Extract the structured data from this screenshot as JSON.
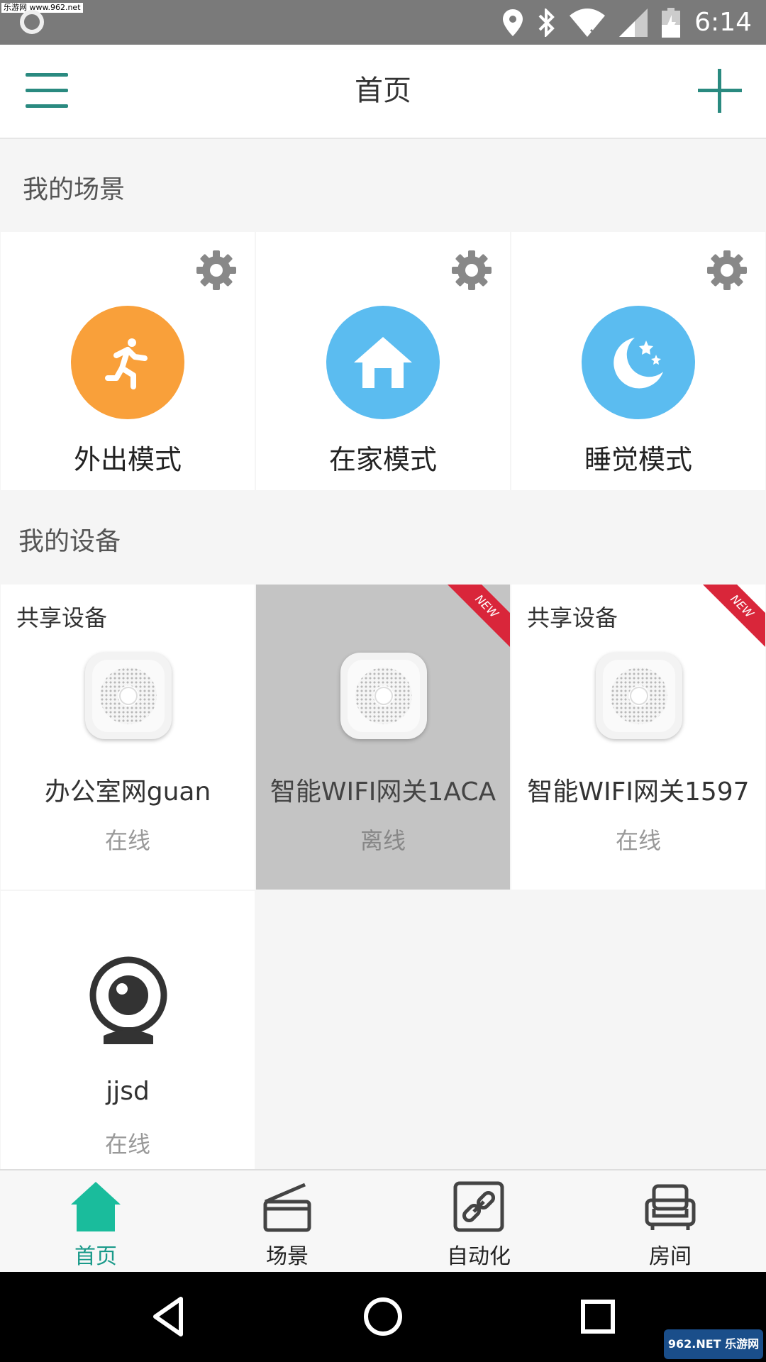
{
  "status_bar": {
    "time": "6:14",
    "watermark": "乐游网 www.962.net"
  },
  "header": {
    "title": "首页"
  },
  "scenes": {
    "section_label": "我的场景",
    "items": [
      {
        "name": "外出模式",
        "color": "#f9a03a",
        "icon": "running-person-icon"
      },
      {
        "name": "在家模式",
        "color": "#5bbcf0",
        "icon": "home-icon"
      },
      {
        "name": "睡觉模式",
        "color": "#5bbcf0",
        "icon": "moon-stars-icon"
      }
    ]
  },
  "devices": {
    "section_label": "我的设备",
    "items": [
      {
        "shared_label": "共享设备",
        "name": "办公室网guan",
        "status": "在线",
        "is_new": false,
        "offline": false
      },
      {
        "shared_label": "",
        "name": "智能WIFI网关1ACA",
        "status": "离线",
        "is_new": true,
        "offline": true
      },
      {
        "shared_label": "共享设备",
        "name": "智能WIFI网关1597",
        "status": "在线",
        "is_new": true,
        "offline": false
      },
      {
        "shared_label": "",
        "name": "jjsd",
        "status": "在线",
        "is_new": false,
        "offline": false
      }
    ],
    "new_badge": "NEW"
  },
  "bottom_nav": {
    "items": [
      {
        "label": "首页",
        "icon": "home-icon",
        "active": true
      },
      {
        "label": "场景",
        "icon": "clapperboard-icon",
        "active": false
      },
      {
        "label": "自动化",
        "icon": "link-icon",
        "active": false
      },
      {
        "label": "房间",
        "icon": "sofa-icon",
        "active": false
      }
    ]
  },
  "corner_watermark": "962.NET 乐游网",
  "colors": {
    "accent": "#2a8a80",
    "active_nav": "#1abc9c",
    "new_badge": "#d9263a"
  }
}
